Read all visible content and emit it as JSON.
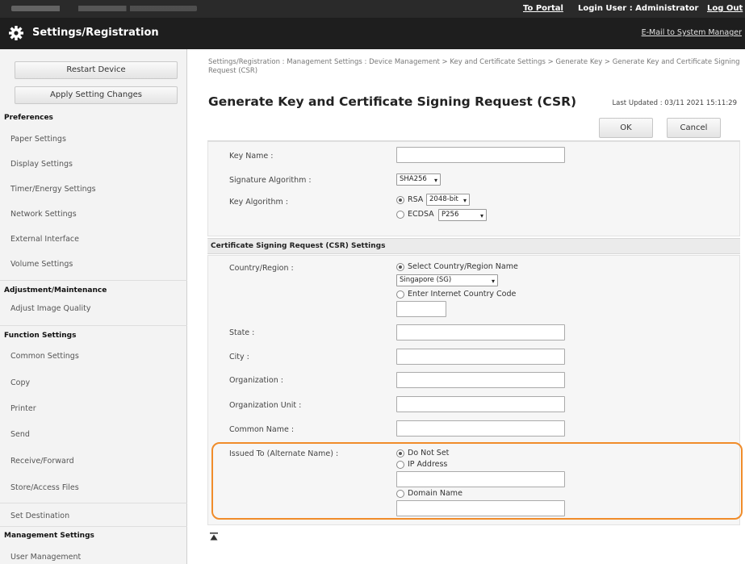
{
  "topbar": {
    "portal_link": "To Portal",
    "login_user": "Login User : Administrator",
    "logout": "Log Out"
  },
  "header": {
    "title": "Settings/Registration",
    "mail_link": "E-Mail to System Manager",
    "icon": "gear-icon"
  },
  "sidebar": {
    "restart_button": "Restart Device",
    "apply_button": "Apply Setting Changes",
    "groups": [
      {
        "heading": "Preferences",
        "items": [
          "Paper Settings",
          "Display Settings",
          "Timer/Energy Settings",
          "Network Settings",
          "External Interface",
          "Volume Settings"
        ]
      },
      {
        "heading": "Adjustment/Maintenance",
        "items": [
          "Adjust Image Quality"
        ]
      },
      {
        "heading": "Function Settings",
        "items": [
          "Common Settings",
          "Copy",
          "Printer",
          "Send",
          "Receive/Forward",
          "Store/Access Files"
        ]
      },
      {
        "heading": "",
        "items": [
          "Set Destination"
        ]
      },
      {
        "heading": "Management Settings",
        "items": [
          "User Management"
        ]
      }
    ]
  },
  "main": {
    "breadcrumb": "Settings/Registration : Management Settings : Device Management > Key and Certificate Settings > Generate Key > Generate Key and Certificate Signing Request (CSR)",
    "title": "Generate Key and Certificate Signing Request (CSR)",
    "last_updated": "Last Updated : 03/11 2021 15:11:29",
    "ok_button": "OK",
    "cancel_button": "Cancel",
    "key": {
      "key_name_label": "Key Name :",
      "key_name_value": "",
      "sig_label": "Signature Algorithm :",
      "sig_value": "SHA256",
      "keyalg_label": "Key Algorithm :",
      "rsa_label": "RSA",
      "rsa_bits": "2048-bit",
      "ecdsa_label": "ECDSA",
      "ecdsa_curve": "P256"
    },
    "csr": {
      "section_title": "Certificate Signing Request (CSR) Settings",
      "country_label": "Country/Region :",
      "country_opt_select": "Select Country/Region Name",
      "country_value": "Singapore (SG)",
      "country_opt_enter": "Enter Internet Country Code",
      "state_label": "State :",
      "city_label": "City :",
      "org_label": "Organization :",
      "org_unit_label": "Organization Unit :",
      "common_name_label": "Common Name :",
      "issued_label": "Issued To (Alternate Name) :",
      "issued_opt_none": "Do Not Set",
      "issued_opt_ip": "IP Address",
      "issued_opt_domain": "Domain Name"
    }
  }
}
